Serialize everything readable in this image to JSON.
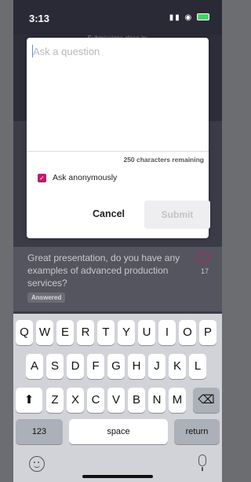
{
  "status_bar": {
    "time": "3:13",
    "signal": "▮▮",
    "wifi": "◉"
  },
  "background": {
    "header_text": "Submissions close in:",
    "question_text": "Great presentation, do you have any examples of advanced production services?",
    "upvote_count": "17",
    "badge": "Answered"
  },
  "modal": {
    "input_placeholder": "Ask a question",
    "chars_remaining": "250 characters remaining",
    "anonymous_label": "Ask anonymously",
    "anonymous_checked": true,
    "cancel_label": "Cancel",
    "submit_label": "Submit"
  },
  "keyboard": {
    "row1": [
      "Q",
      "W",
      "E",
      "R",
      "T",
      "Y",
      "U",
      "I",
      "O",
      "P"
    ],
    "row2": [
      "A",
      "S",
      "D",
      "F",
      "G",
      "H",
      "J",
      "K",
      "L"
    ],
    "row3": [
      "Z",
      "X",
      "C",
      "V",
      "B",
      "N",
      "M"
    ],
    "shift_icon": "⬆",
    "delete_icon": "⌫",
    "numbers_label": "123",
    "space_label": "space",
    "return_label": "return"
  },
  "colors": {
    "accent": "#c2186e"
  }
}
